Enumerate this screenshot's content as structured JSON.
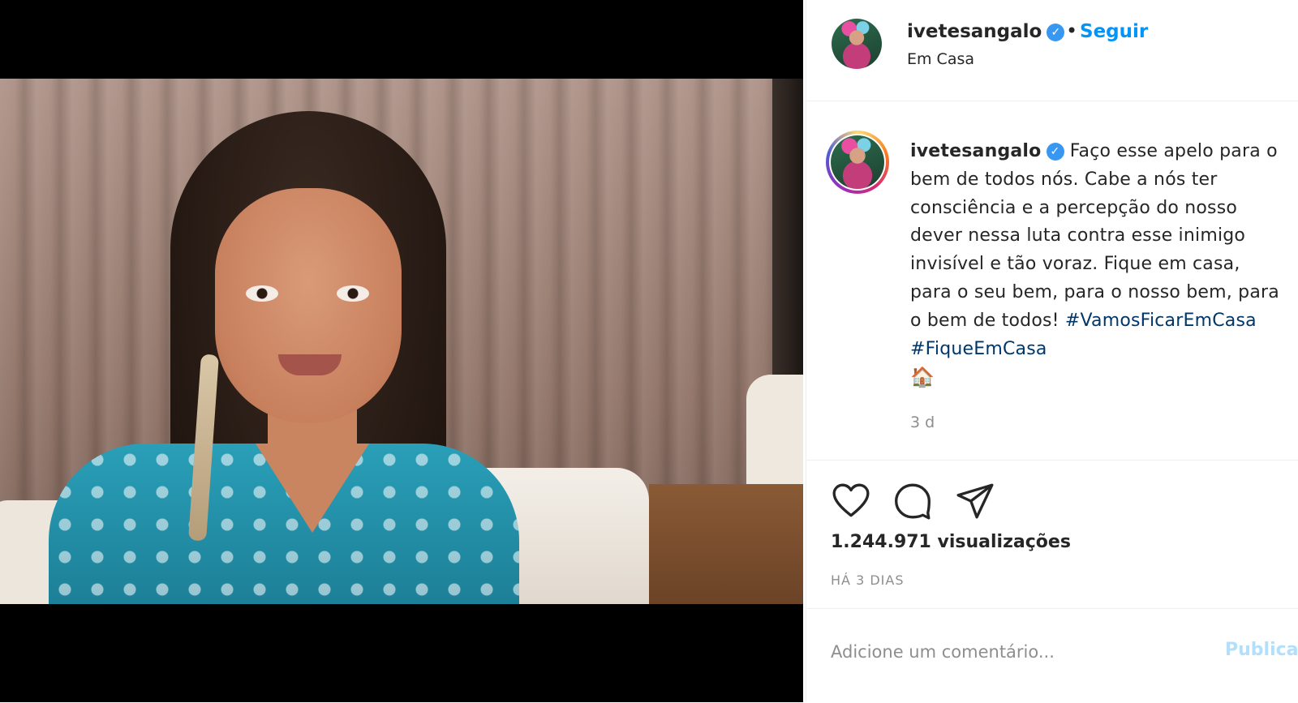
{
  "header": {
    "username": "ivetesangalo",
    "separator": "•",
    "follow_label": "Seguir",
    "location": "Em Casa"
  },
  "caption": {
    "username": "ivetesangalo",
    "text": "Faço esse apelo para o bem de todos nós. Cabe a nós ter consciência e a percepção do nosso dever nessa luta contra esse inimigo invisível e tão voraz. Fique em casa, para o seu bem, para o nosso bem, para o bem de todos!",
    "hashtags": [
      "#VamosFicarEmCasa",
      "#FiqueEmCasa"
    ],
    "emoji": "🏠",
    "time_ago": "3 d"
  },
  "actions": {
    "icons": [
      "heart-icon",
      "comment-icon",
      "share-icon"
    ]
  },
  "stats": {
    "views": "1.244.971 visualizações",
    "date": "HÁ 3 DIAS"
  },
  "comment_box": {
    "placeholder": "Adicione um comentário...",
    "publish_label": "Publicar"
  },
  "colors": {
    "accent": "#0095f6",
    "verified": "#3897f0",
    "hashtag": "#00376b",
    "muted": "#8e8e8e",
    "publish_disabled": "#b2dffc"
  }
}
